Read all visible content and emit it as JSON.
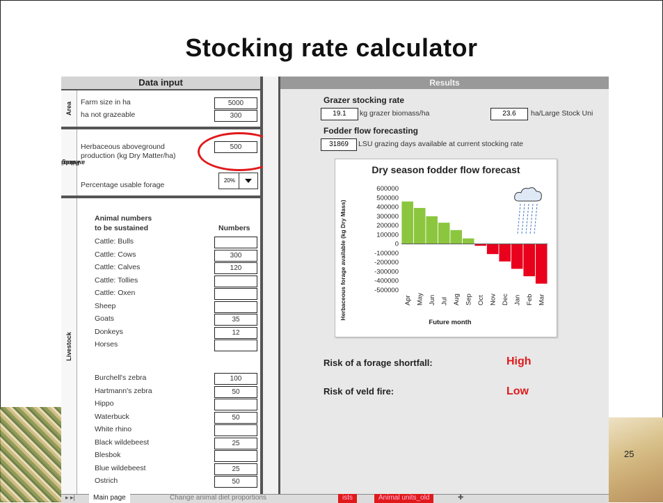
{
  "title": "Stocking rate calculator",
  "left_panel": {
    "header": "Data input",
    "area": {
      "section_label": "Area",
      "farm_size_label": "Farm size in ha",
      "farm_size_value": "5000",
      "not_grazeable_label": "ha not grazeable",
      "not_grazeable_value": "300"
    },
    "forage": {
      "section_label_1": "Forage",
      "section_label_2": "availability",
      "herb_label_1": "Herbaceous aboveground",
      "herb_label_2": "production (kg Dry Matter/ha)",
      "herb_value": "500",
      "pct_label": "Percentage usable forage",
      "pct_value": "20%"
    },
    "livestock": {
      "section_label": "Livestock",
      "heading_1": "Animal numbers",
      "heading_2": "to be sustained",
      "numbers_header": "Numbers",
      "domestic": [
        {
          "name": "Cattle: Bulls",
          "value": ""
        },
        {
          "name": "Cattle: Cows",
          "value": "300"
        },
        {
          "name": "Cattle: Calves",
          "value": "120"
        },
        {
          "name": "Cattle: Tollies",
          "value": ""
        },
        {
          "name": "Cattle: Oxen",
          "value": ""
        },
        {
          "name": "Sheep",
          "value": ""
        },
        {
          "name": "Goats",
          "value": "35"
        },
        {
          "name": "Donkeys",
          "value": "12"
        },
        {
          "name": "Horses",
          "value": ""
        }
      ],
      "wild": [
        {
          "name": "Burchell's zebra",
          "value": "100"
        },
        {
          "name": "Hartmann's zebra",
          "value": "50"
        },
        {
          "name": "Hippo",
          "value": ""
        },
        {
          "name": "Waterbuck",
          "value": "50"
        },
        {
          "name": "White rhino",
          "value": ""
        },
        {
          "name": "Black wildebeest",
          "value": "25"
        },
        {
          "name": "Blesbok",
          "value": ""
        },
        {
          "name": "Blue wildebeest",
          "value": "25"
        },
        {
          "name": "Ostrich",
          "value": "50"
        }
      ]
    }
  },
  "right_panel": {
    "header": "Results",
    "grazer_heading": "Grazer stocking rate",
    "biomass_value": "19.1",
    "biomass_label": "kg grazer biomass/ha",
    "ha_lsu_value": "23.6",
    "ha_lsu_label": "ha/Large Stock Uni",
    "fodder_heading": "Fodder flow forecasting",
    "lsu_days_value": "31869",
    "lsu_days_label": "LSU grazing days available at current stocking rate",
    "risk_shortfall_label": "Risk of a forage shortfall:",
    "risk_shortfall_value": "High",
    "risk_fire_label": "Risk of veld fire:",
    "risk_fire_value": "Low"
  },
  "chart_data": {
    "type": "bar",
    "title": "Dry season fodder flow forecast",
    "xlabel": "Future month",
    "ylabel": "Herbaceous forage available (kg Dry Mass)",
    "categories": [
      "Apr",
      "May",
      "Jun",
      "Jul",
      "Aug",
      "Sep",
      "Oct",
      "Nov",
      "Dec",
      "Jan",
      "Feb",
      "Mar"
    ],
    "values": [
      460000,
      390000,
      300000,
      230000,
      150000,
      60000,
      -20000,
      -110000,
      -190000,
      -270000,
      -350000,
      -430000
    ],
    "y_ticks": [
      "600000",
      "500000",
      "400000",
      "300000",
      "200000",
      "100000",
      "0",
      "-100000",
      "-200000",
      "-300000",
      "-400000",
      "-500000"
    ],
    "ylim": [
      -500000,
      600000
    ],
    "positive_color": "#8cc63f",
    "negative_color": "#e8001c",
    "annotation_icon": "rain-cloud-icon"
  },
  "tabs": [
    {
      "label": "Main page",
      "state": "active"
    },
    {
      "label": "Change animal diet proportions",
      "state": "normal"
    },
    {
      "label": "ists",
      "state": "red"
    },
    {
      "label": "Animal units_old",
      "state": "red"
    }
  ],
  "page_number": "25",
  "colors": {
    "accent_red": "#e0191b",
    "panel_border": "#555555"
  }
}
